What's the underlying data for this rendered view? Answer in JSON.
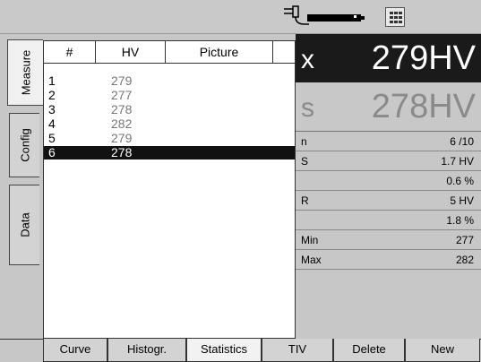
{
  "status": {
    "plug_icon": "power-plug-battery-icon",
    "calc_icon": "calculator-icon"
  },
  "side_tabs": [
    {
      "label": "Measure",
      "active": true
    },
    {
      "label": "Config",
      "active": false
    },
    {
      "label": "Data",
      "active": false
    }
  ],
  "table": {
    "headers": [
      "#",
      "HV",
      "Picture"
    ],
    "rows": [
      {
        "n": "1",
        "hv": "279"
      },
      {
        "n": "2",
        "hv": "277"
      },
      {
        "n": "3",
        "hv": "278"
      },
      {
        "n": "4",
        "hv": "282"
      },
      {
        "n": "5",
        "hv": "279"
      },
      {
        "n": "6",
        "hv": "278"
      }
    ],
    "selected_row": 6
  },
  "mean": {
    "symbol": "x",
    "value": "279",
    "unit": "HV"
  },
  "last": {
    "symbol": "s",
    "value": "278",
    "unit": "HV"
  },
  "stats": [
    {
      "label": "n",
      "value": "6 /10"
    },
    {
      "label": "S",
      "value": "1.7 HV"
    },
    {
      "label": "",
      "value": "0.6 %"
    },
    {
      "label": "R",
      "value": "5 HV"
    },
    {
      "label": "",
      "value": "1.8 %"
    },
    {
      "label": "Min",
      "value": "277"
    },
    {
      "label": "Max",
      "value": "282"
    }
  ],
  "bottom_tabs": [
    {
      "label": "Curve"
    },
    {
      "label": "Histogr."
    },
    {
      "label": "Statistics",
      "active": true
    },
    {
      "label": "TIV"
    },
    {
      "label": "Delete"
    },
    {
      "label": "New"
    }
  ]
}
